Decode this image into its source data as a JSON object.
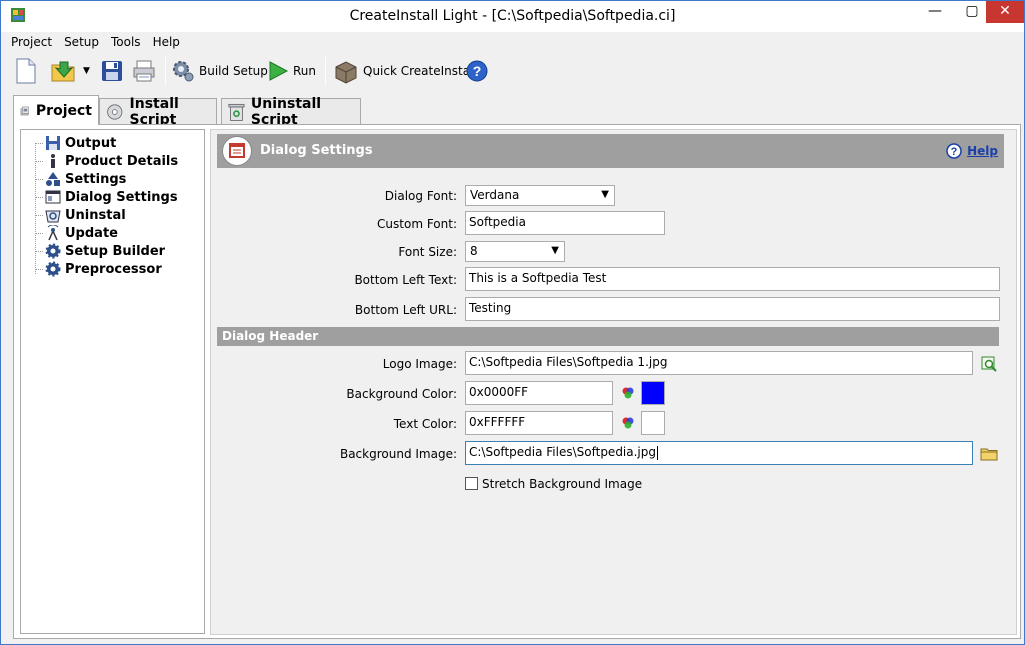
{
  "window": {
    "title": "CreateInstall Light - [C:\\Softpedia\\Softpedia.ci]",
    "min_glyph": "—",
    "max_glyph": "▢",
    "close_glyph": "✕"
  },
  "menu": [
    "Project",
    "Setup",
    "Tools",
    "Help"
  ],
  "toolbar": {
    "build_label": "Build Setup",
    "run_label": "Run",
    "quick_label": "Quick CreateInstall"
  },
  "tabs": [
    {
      "label": "Project",
      "active": true
    },
    {
      "label": "Install Script",
      "active": false
    },
    {
      "label": "Uninstall Script",
      "active": false
    }
  ],
  "tree": [
    {
      "label": "Output",
      "icon": "floppy-icon"
    },
    {
      "label": "Product Details",
      "icon": "info-icon"
    },
    {
      "label": "Settings",
      "icon": "shapes-icon"
    },
    {
      "label": "Dialog Settings",
      "icon": "dialog-icon"
    },
    {
      "label": "Uninstal",
      "icon": "uninstall-icon"
    },
    {
      "label": "Update",
      "icon": "antenna-icon"
    },
    {
      "label": "Setup Builder",
      "icon": "gear-icon"
    },
    {
      "label": "Preprocessor",
      "icon": "gear-icon"
    }
  ],
  "panel": {
    "title": "Dialog Settings",
    "help_label": "Help"
  },
  "form": {
    "dialog_font_label": "Dialog Font:",
    "dialog_font_value": "Verdana",
    "custom_font_label": "Custom Font:",
    "custom_font_value": "Softpedia",
    "font_size_label": "Font Size:",
    "font_size_value": "8",
    "bottom_left_text_label": "Bottom Left Text:",
    "bottom_left_text_value": "This is a Softpedia Test",
    "bottom_left_url_label": "Bottom Left URL:",
    "bottom_left_url_value": "Testing"
  },
  "dialog_header": {
    "section_label": "Dialog Header",
    "logo_image_label": "Logo Image:",
    "logo_image_value": "C:\\Softpedia Files\\Softpedia 1.jpg",
    "bg_color_label": "Background Color:",
    "bg_color_value": "0x0000FF",
    "bg_color_swatch": "#0000ff",
    "text_color_label": "Text Color:",
    "text_color_value": "0xFFFFFF",
    "text_color_swatch": "#ffffff",
    "bg_image_label": "Background Image:",
    "bg_image_value": "C:\\Softpedia Files\\Softpedia.jpg",
    "stretch_label": "Stretch Background Image",
    "stretch_checked": false
  }
}
